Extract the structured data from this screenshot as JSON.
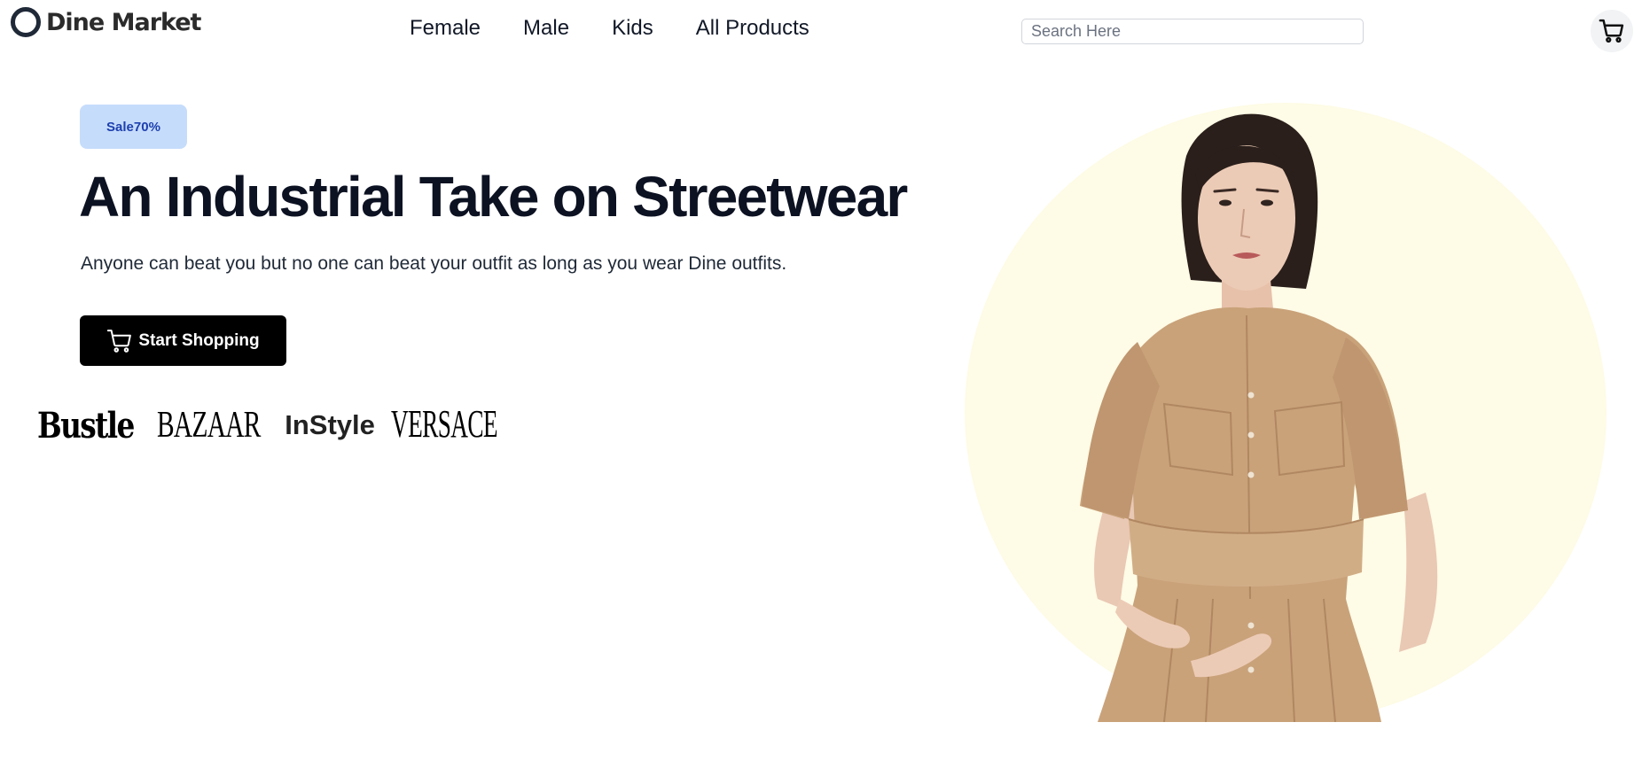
{
  "brand": {
    "name": "Dine Market"
  },
  "nav": {
    "items": [
      {
        "label": "Female"
      },
      {
        "label": "Male"
      },
      {
        "label": "Kids"
      },
      {
        "label": "All Products"
      }
    ]
  },
  "search": {
    "placeholder": "Search Here",
    "value": ""
  },
  "cart": {
    "icon": "cart-icon"
  },
  "hero": {
    "badge": "Sale70%",
    "title": "An Industrial Take on Streetwear",
    "subtitle": "Anyone can beat you but no one can beat your outfit as long as you wear Dine outfits.",
    "cta_label": "Start Shopping",
    "cta_icon": "cart-icon"
  },
  "featured_brands": [
    {
      "name": "Bustle"
    },
    {
      "name": "BAZAAR"
    },
    {
      "name": "InStyle"
    },
    {
      "name": "VERSACE"
    }
  ],
  "colors": {
    "badge_bg": "#c6dcfb",
    "badge_text": "#1e40af",
    "button_bg": "#000000",
    "circle_bg": "#fefbe6",
    "dress": "#c9a27a"
  }
}
